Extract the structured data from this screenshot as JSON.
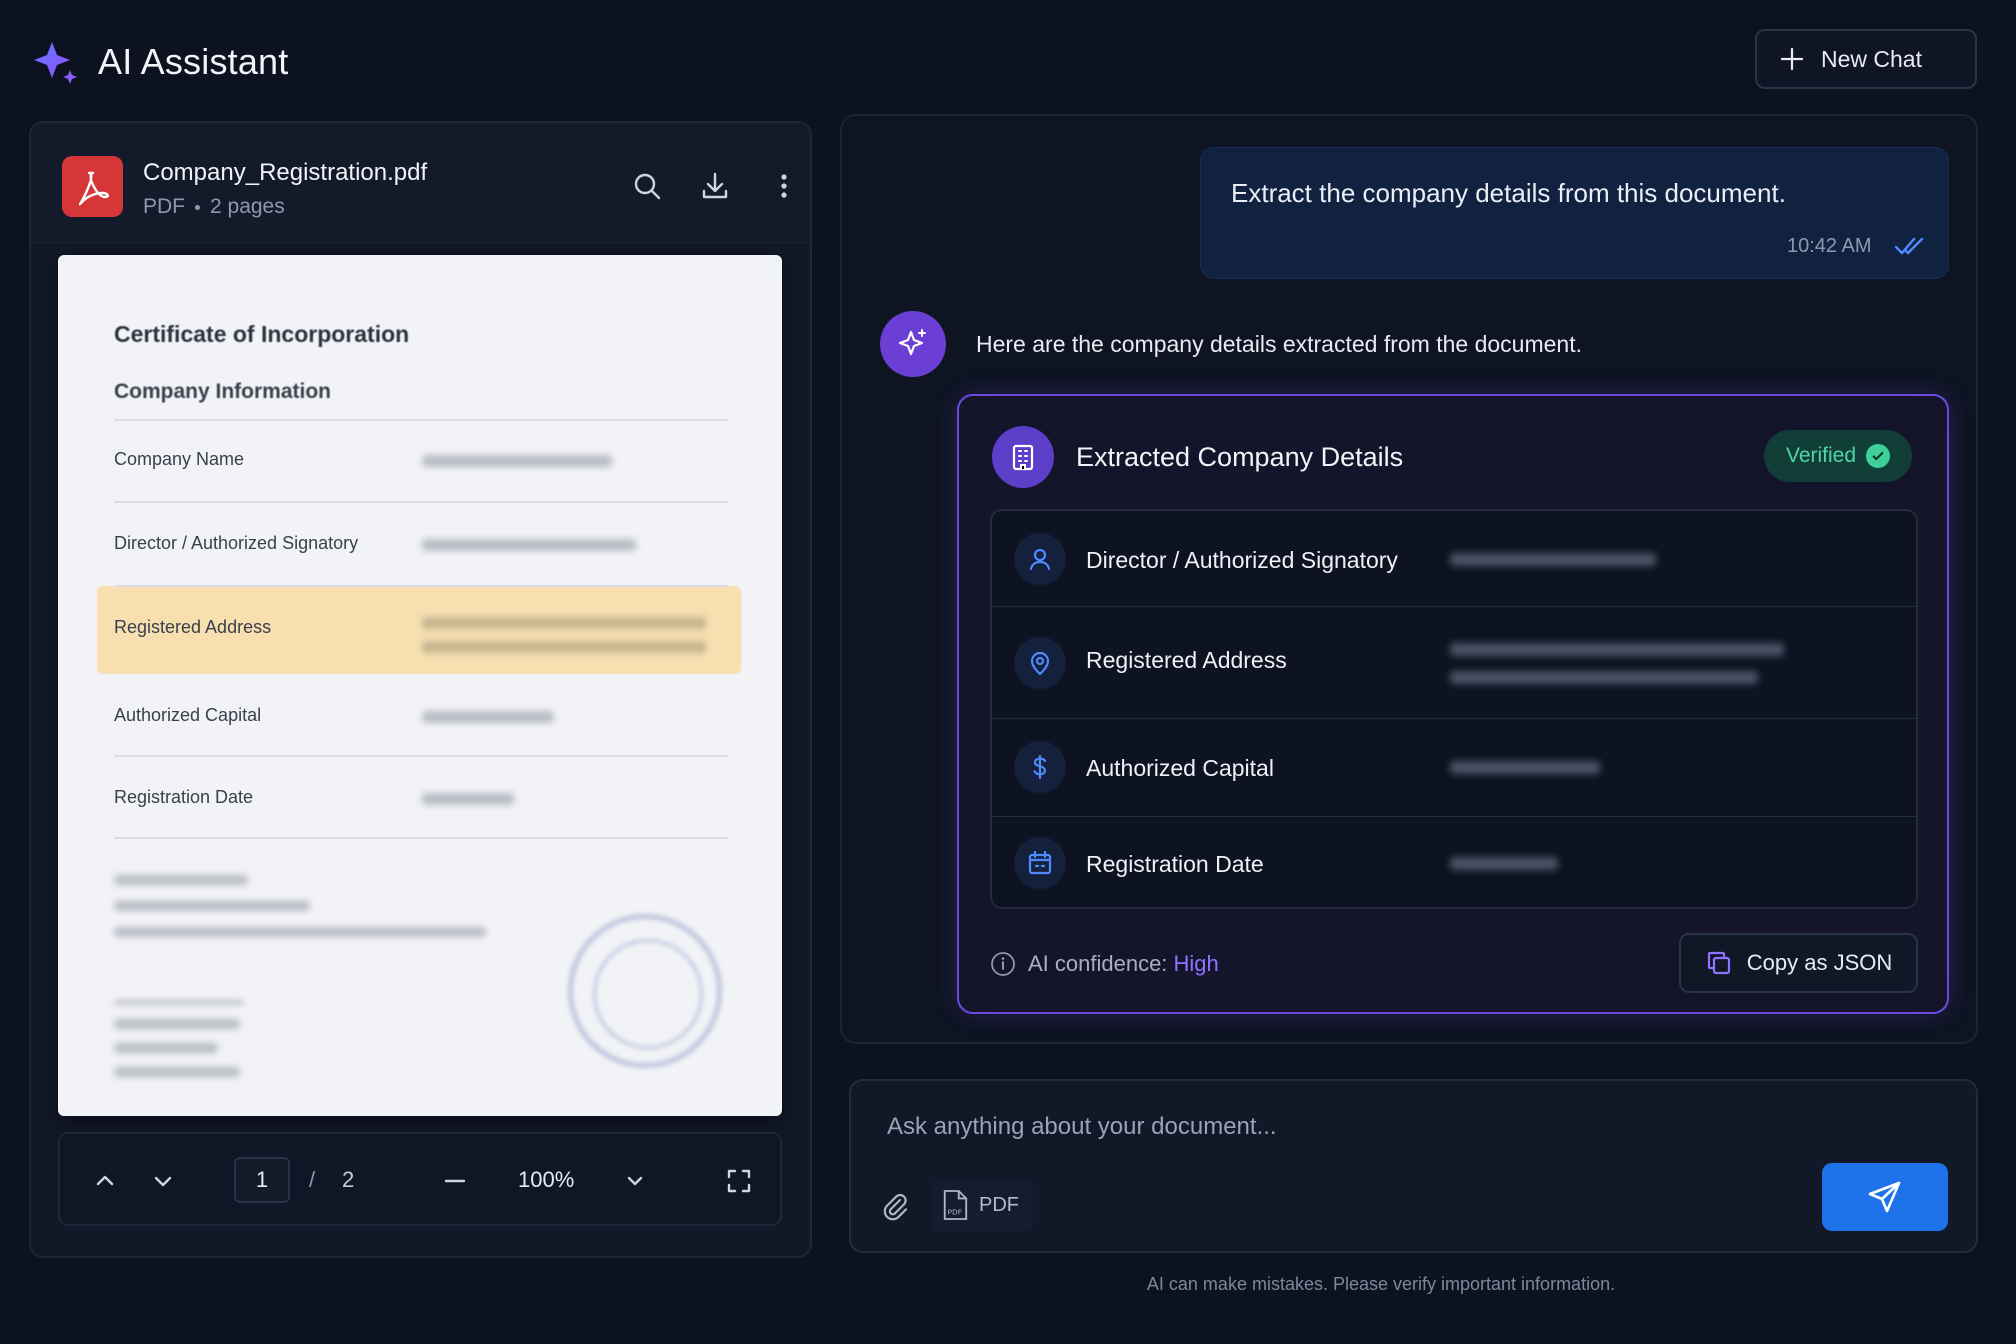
{
  "header": {
    "title": "AI Assistant",
    "new_chat_label": "New Chat"
  },
  "viewer": {
    "file_name": "Company_Registration.pdf",
    "file_type": "PDF",
    "page_count_label": "2 pages",
    "document": {
      "title": "Certificate of Incorporation",
      "section": "Company Information",
      "rows": [
        {
          "label": "Company Name"
        },
        {
          "label": "Director / Authorized Signatory"
        },
        {
          "label": "Registered Address",
          "highlighted": true
        },
        {
          "label": "Authorized Capital"
        },
        {
          "label": "Registration Date"
        }
      ]
    },
    "controls": {
      "current_page": "1",
      "separator": "/",
      "total_pages": "2",
      "zoom": "100%"
    }
  },
  "chat": {
    "user_message": {
      "text": "Extract the company details from this document.",
      "time": "10:42 AM"
    },
    "ai_message": {
      "text": "Here are the company details extracted from the document."
    },
    "details_card": {
      "title": "Extracted Company Details",
      "badge": "Verified",
      "fields": [
        {
          "label": "Director / Authorized Signatory",
          "icon": "user-icon"
        },
        {
          "label": "Registered Address",
          "icon": "location-pin-icon"
        },
        {
          "label": "Authorized Capital",
          "icon": "dollar-icon"
        },
        {
          "label": "Registration Date",
          "icon": "calendar-icon"
        }
      ],
      "confidence_label": "AI confidence:",
      "confidence_value": "High",
      "copy_label": "Copy as JSON"
    }
  },
  "composer": {
    "placeholder": "Ask anything about your document...",
    "attachment_label": "PDF"
  },
  "footer": {
    "note": "AI can make mistakes. Please verify important information."
  },
  "colors": {
    "background": "#0c1220",
    "accent_purple": "#6e49de",
    "accent_blue": "#1e73ea",
    "success_green": "#3fcf9a",
    "pdf_red": "#d63638",
    "highlight_amber": "#f7dfb0"
  }
}
